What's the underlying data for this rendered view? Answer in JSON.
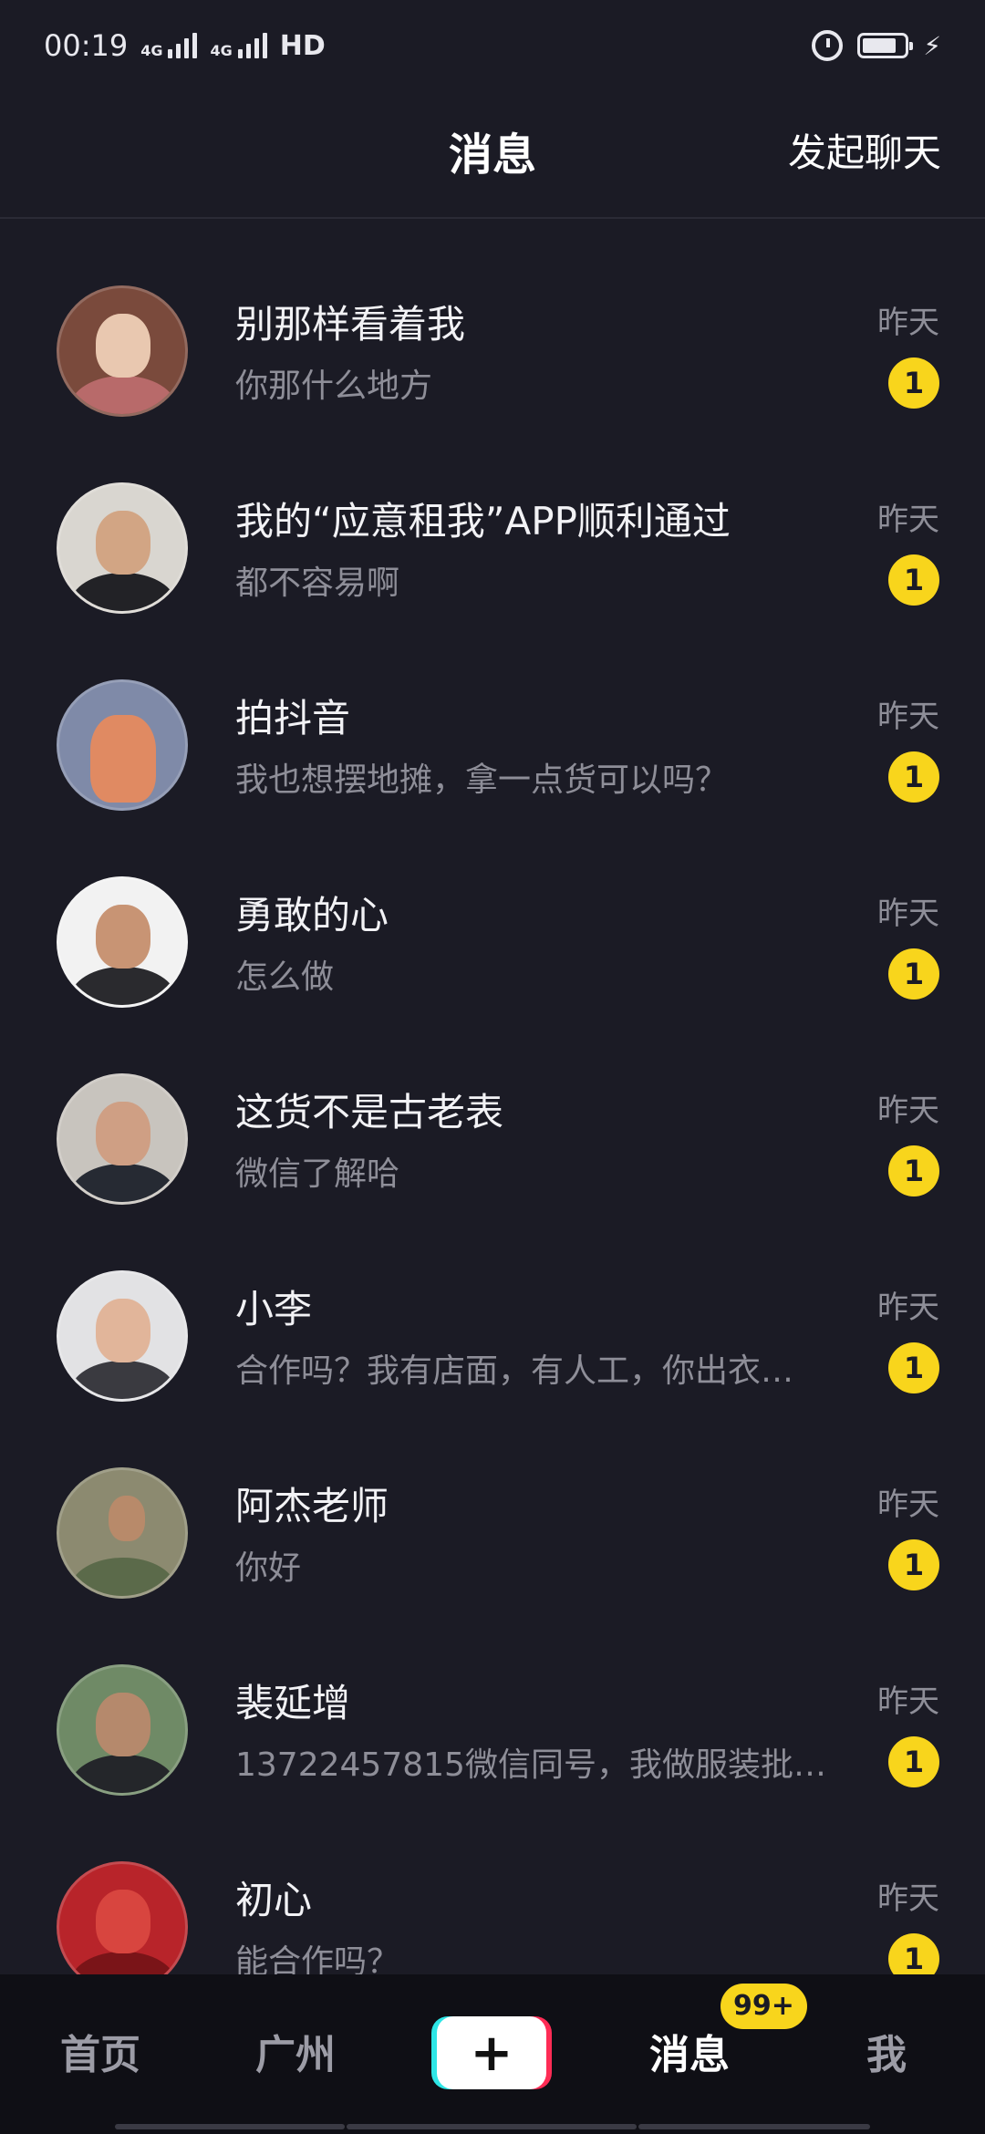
{
  "status_bar": {
    "time": "00:19",
    "signal_1_label": "4G",
    "signal_2_label": "4G",
    "hd_label": "HD",
    "icons": [
      "signal-icon",
      "alarm-icon",
      "battery-icon",
      "charging-icon"
    ]
  },
  "header": {
    "title": "消息",
    "start_chat": "发起聊天"
  },
  "conversations": [
    {
      "name": "别那样看着我",
      "preview": "你那什么地方",
      "time": "昨天",
      "unread": "1"
    },
    {
      "name": "我的“应意租我”APP顺利通过",
      "preview": "都不容易啊",
      "time": "昨天",
      "unread": "1"
    },
    {
      "name": "拍抖音",
      "preview": "我也想摆地摊，拿一点货可以吗？",
      "time": "昨天",
      "unread": "1"
    },
    {
      "name": "勇敢的心",
      "preview": "怎么做",
      "time": "昨天",
      "unread": "1"
    },
    {
      "name": "这货不是古老表",
      "preview": "微信了解哈",
      "time": "昨天",
      "unread": "1"
    },
    {
      "name": "小李",
      "preview": "合作吗？我有店面，有人工，你出衣…",
      "time": "昨天",
      "unread": "1"
    },
    {
      "name": "阿杰老师",
      "preview": "你好",
      "time": "昨天",
      "unread": "1"
    },
    {
      "name": "裴延增",
      "preview": "13722457815微信同号，我做服装批…",
      "time": "昨天",
      "unread": "1"
    },
    {
      "name": "初心",
      "preview": "能合作吗？",
      "time": "昨天",
      "unread": "1"
    }
  ],
  "bottom_nav": {
    "home": "首页",
    "city": "广州",
    "create_label": "+",
    "messages": "消息",
    "messages_badge": "99+",
    "me": "我"
  },
  "colors": {
    "background": "#1b1b25",
    "badge_yellow": "#f8d51c",
    "secondary_text": "#8e8e98",
    "nav_background": "#0f0f15"
  }
}
